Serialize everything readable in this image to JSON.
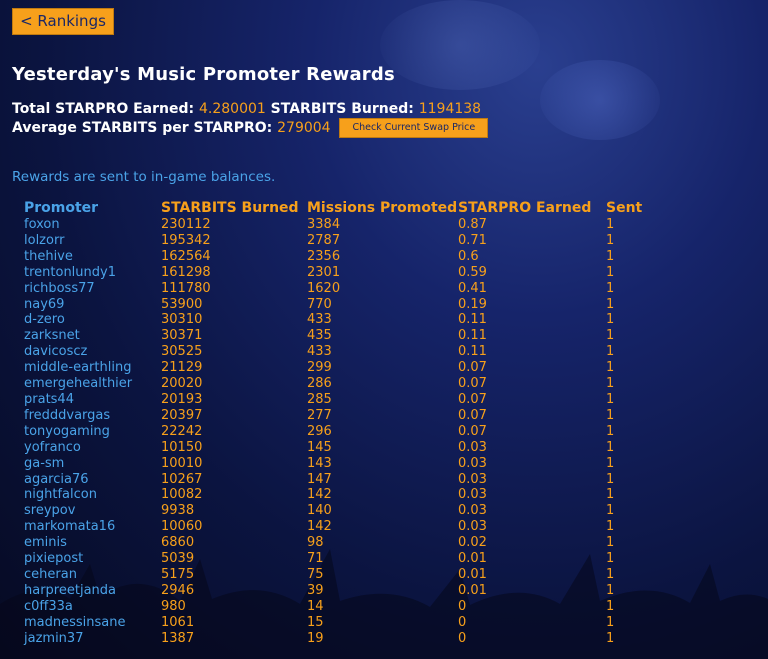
{
  "nav": {
    "back_label": "< Rankings"
  },
  "header": {
    "title": "Yesterday's Music Promoter Rewards"
  },
  "stats": {
    "total_starpro_label": "Total STARPRO Earned:",
    "total_starpro_value": "4.280001",
    "starbits_burned_label": "STARBITS Burned:",
    "starbits_burned_value": "1194138",
    "average_label": "Average STARBITS per STARPRO:",
    "average_value": "279004",
    "swap_button_label": "Check Current Swap Price"
  },
  "note": "Rewards are sent to in-game balances.",
  "colors": {
    "accent": "#f7a01b",
    "link": "#4aa3e8",
    "background": "#0b1440"
  },
  "table": {
    "headers": [
      "Promoter",
      "STARBITS Burned",
      "Missions Promoted",
      "STARPRO Earned",
      "Sent"
    ],
    "rows": [
      [
        "foxon",
        "230112",
        "3384",
        "0.87",
        "1"
      ],
      [
        "lolzorr",
        "195342",
        "2787",
        "0.71",
        "1"
      ],
      [
        "thehive",
        "162564",
        "2356",
        "0.6",
        "1"
      ],
      [
        "trentonlundy1",
        "161298",
        "2301",
        "0.59",
        "1"
      ],
      [
        "richboss77",
        "111780",
        "1620",
        "0.41",
        "1"
      ],
      [
        "nay69",
        "53900",
        "770",
        "0.19",
        "1"
      ],
      [
        "d-zero",
        "30310",
        "433",
        "0.11",
        "1"
      ],
      [
        "zarksnet",
        "30371",
        "435",
        "0.11",
        "1"
      ],
      [
        "davicoscz",
        "30525",
        "433",
        "0.11",
        "1"
      ],
      [
        "middle-earthling",
        "21129",
        "299",
        "0.07",
        "1"
      ],
      [
        "emergehealthier",
        "20020",
        "286",
        "0.07",
        "1"
      ],
      [
        "prats44",
        "20193",
        "285",
        "0.07",
        "1"
      ],
      [
        "fredddvargas",
        "20397",
        "277",
        "0.07",
        "1"
      ],
      [
        "tonyogaming",
        "22242",
        "296",
        "0.07",
        "1"
      ],
      [
        "yofranco",
        "10150",
        "145",
        "0.03",
        "1"
      ],
      [
        "ga-sm",
        "10010",
        "143",
        "0.03",
        "1"
      ],
      [
        "agarcia76",
        "10267",
        "147",
        "0.03",
        "1"
      ],
      [
        "nightfalcon",
        "10082",
        "142",
        "0.03",
        "1"
      ],
      [
        "sreypov",
        "9938",
        "140",
        "0.03",
        "1"
      ],
      [
        "markomata16",
        "10060",
        "142",
        "0.03",
        "1"
      ],
      [
        "eminis",
        "6860",
        "98",
        "0.02",
        "1"
      ],
      [
        "pixiepost",
        "5039",
        "71",
        "0.01",
        "1"
      ],
      [
        "ceheran",
        "5175",
        "75",
        "0.01",
        "1"
      ],
      [
        "harpreetjanda",
        "2946",
        "39",
        "0.01",
        "1"
      ],
      [
        "c0ff33a",
        "980",
        "14",
        "0",
        "1"
      ],
      [
        "madnessinsane",
        "1061",
        "15",
        "0",
        "1"
      ],
      [
        "jazmin37",
        "1387",
        "19",
        "0",
        "1"
      ]
    ]
  }
}
